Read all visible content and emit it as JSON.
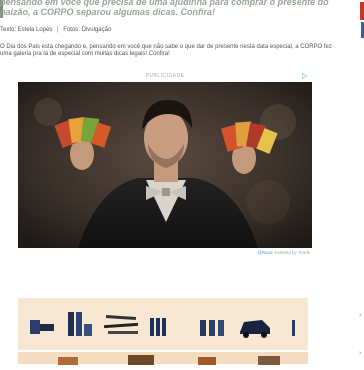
{
  "article": {
    "lead": "pensando em você que precisa de uma ajudinha para comprar o presente do paizão, a CORPO separou algumas dicas. Confira!",
    "credits": {
      "text_label": "Texto: Estela Lopes",
      "separator": "|",
      "photos_label": "Fotos: Divulgação"
    },
    "body": "O Dia dos Pais está chegando e, pensando em você que não sabe o que dar de presente nesta data especial, a CORPO fez uma galeria pra lá de especial com muitas dicas legais! Confira!"
  },
  "ad": {
    "label": "PUBLICIDADE",
    "flag_icon": "adchoices-icon",
    "footer_link": "@Read",
    "footer_text": "invented by Teads"
  },
  "gallery": {
    "items": [
      "product-1",
      "product-2",
      "product-3",
      "product-4",
      "product-5",
      "product-6",
      "product-7"
    ]
  },
  "colors": {
    "lead": "#9aa59a",
    "gallery_bg": "#f8e8d3",
    "ad_accent": "#4aa3df"
  }
}
